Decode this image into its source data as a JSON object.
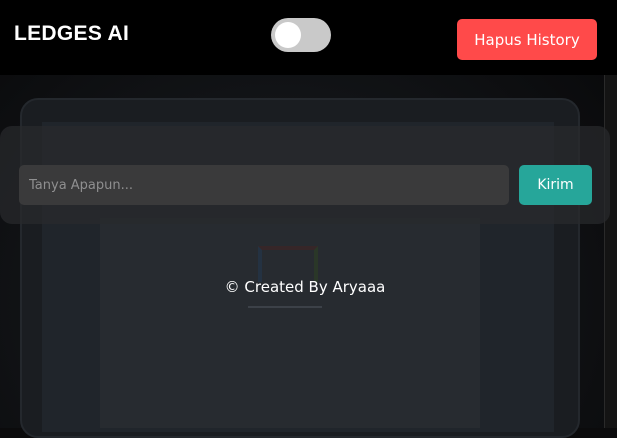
{
  "header": {
    "brand": "LEDGES AI",
    "theme_toggle": {
      "state": "off"
    },
    "clear_history_label": "Hapus History",
    "clear_history_color": "#ff4a4a"
  },
  "chat": {
    "input_value": "",
    "input_placeholder": "Tanya Apapun...",
    "send_label": "Kirim",
    "send_color": "#26a69a"
  },
  "footer": {
    "credit": "© Created By Aryaaa"
  }
}
